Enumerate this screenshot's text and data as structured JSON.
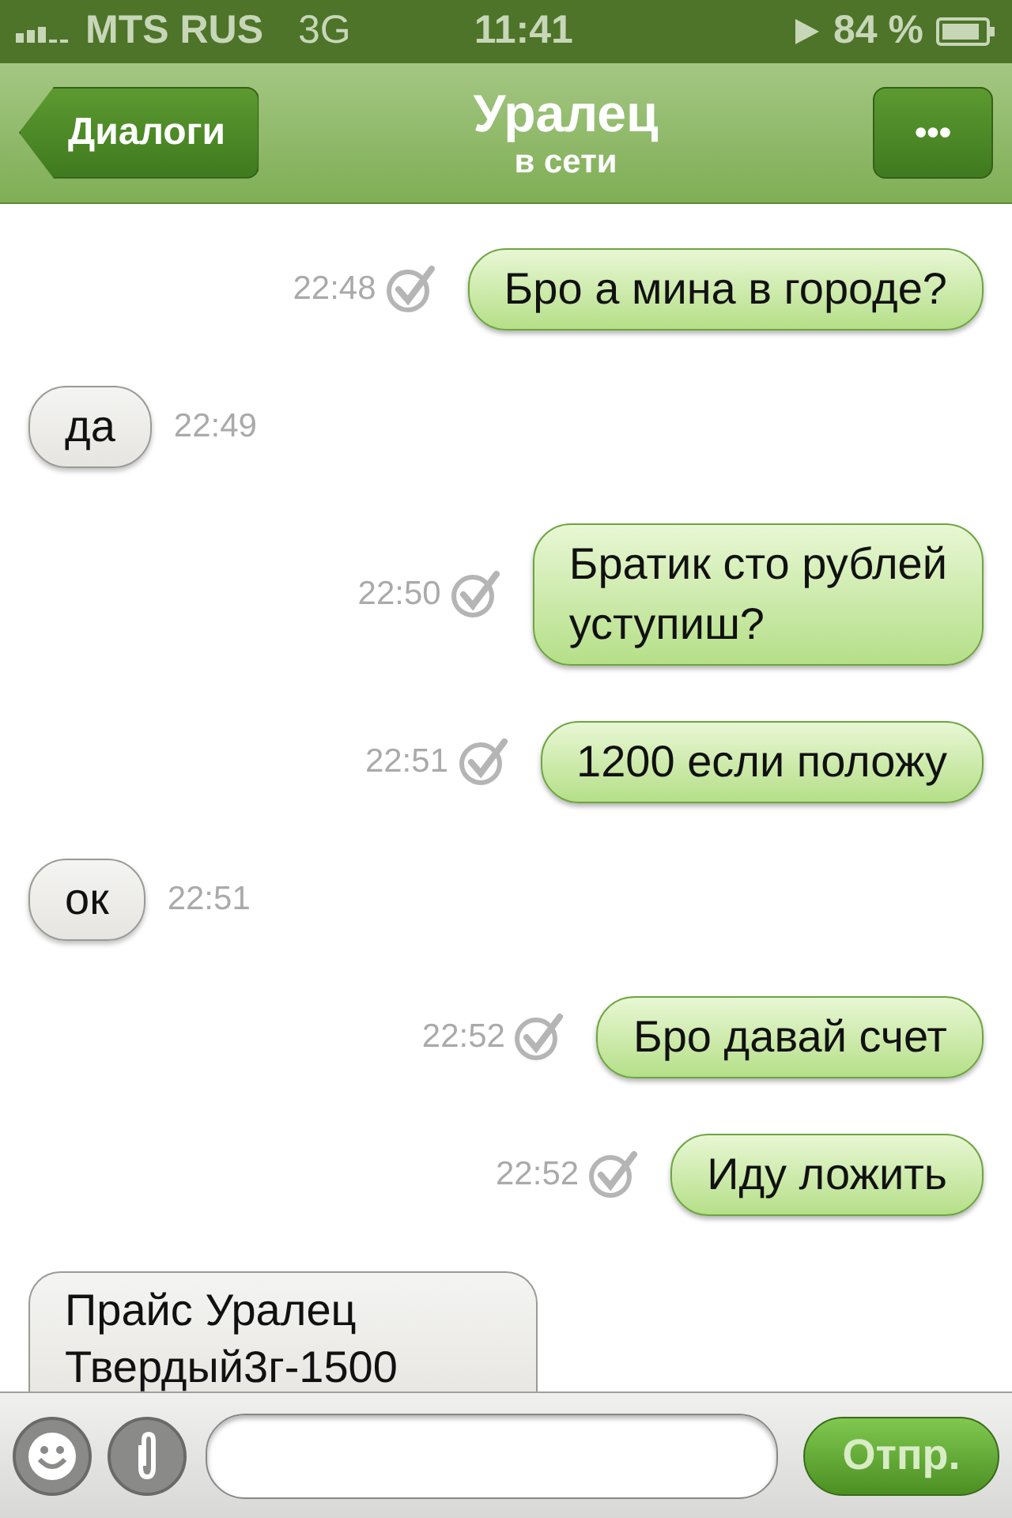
{
  "status_bar": {
    "carrier": "MTS RUS",
    "network": "3G",
    "time": "11:41",
    "battery": "84 %"
  },
  "nav_bar": {
    "back": "Диалоги",
    "title": "Уралец",
    "subtitle": "в сети",
    "menu": "•••"
  },
  "messages": [
    {
      "kind": "outgoing",
      "text": "Бро а мина в городе?",
      "time": "22:48"
    },
    {
      "kind": "incoming",
      "text": "да",
      "time": "22:49"
    },
    {
      "kind": "outgoing",
      "text": "Братик сто рублей\nуступиш?",
      "time": "22:50"
    },
    {
      "kind": "outgoing",
      "text": "1200 если положу",
      "time": "22:51"
    },
    {
      "kind": "incoming",
      "text": "ок",
      "time": "22:51"
    },
    {
      "kind": "outgoing",
      "text": "Бро давай счет",
      "time": "22:52"
    },
    {
      "kind": "outgoing",
      "text": "Иду ложить",
      "time": "22:52"
    },
    {
      "kind": "incoming",
      "text": "Прайс Уралец\nТвердый3г-1500"
    }
  ],
  "input_bar": {
    "send": "Отпр."
  }
}
